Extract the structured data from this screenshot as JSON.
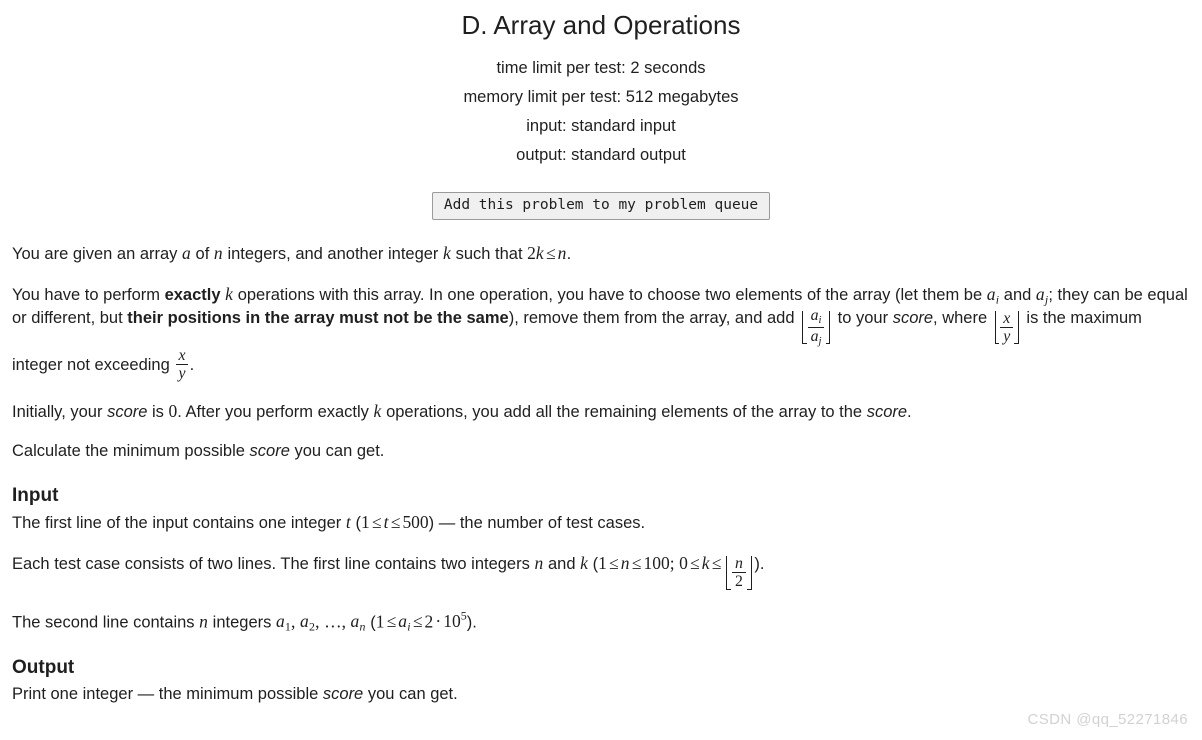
{
  "header": {
    "title": "D. Array and Operations",
    "limits": [
      "time limit per test: 2 seconds",
      "memory limit per test: 512 megabytes",
      "input: standard input",
      "output: standard output"
    ]
  },
  "queue_button": {
    "label": "Add this problem to my problem queue"
  },
  "statement": {
    "p1": {
      "t1": "You are given an array ",
      "a": "a",
      "t2": " of ",
      "n": "n",
      "t3": " integers, and another integer ",
      "k": "k",
      "t4": " such that ",
      "two": "2",
      "k2": "k",
      "le": "≤",
      "n2": "n",
      "t5": "."
    },
    "p2": {
      "t1": "You have to perform ",
      "exactly": "exactly",
      "k": "k",
      "t2": " operations with this array. In one operation, you have to choose two elements of the array (let them be ",
      "a_i_base": "a",
      "a_i_sub": "i",
      "t3": " and ",
      "a_j_base": "a",
      "a_j_sub": "j",
      "t4": "; they can be equal or different, but ",
      "bold_positions": "their positions in the array must not be the same",
      "t5": "), remove them from the array, and add ",
      "frac1_num_base": "a",
      "frac1_num_sub": "i",
      "frac1_den_base": "a",
      "frac1_den_sub": "j",
      "t6": " to your ",
      "score1": "score",
      "t7": ", where ",
      "frac2_num": "x",
      "frac2_den": "y",
      "t8": " is the maximum integer not exceeding ",
      "frac3_num": "x",
      "frac3_den": "y",
      "t9": "."
    },
    "p3": {
      "t1": "Initially, your ",
      "score1": "score",
      "t2": " is ",
      "zero": "0",
      "t3": ". After you perform exactly ",
      "k": "k",
      "t4": " operations, you add all the remaining elements of the array to the ",
      "score2": "score",
      "t5": "."
    },
    "p4": {
      "t1": "Calculate the minimum possible ",
      "score": "score",
      "t2": " you can get."
    }
  },
  "input_section": {
    "heading": "Input",
    "p1": {
      "t1": "The first line of the input contains one integer ",
      "t": "t",
      "t2": " (",
      "one": "1",
      "le1": "≤",
      "t_var": "t",
      "le2": "≤",
      "five_hundred": "500",
      "t3": ") — the number of test cases."
    },
    "p2": {
      "t1": "Each test case consists of two lines. The first line contains two integers ",
      "n": "n",
      "t2": " and ",
      "k": "k",
      "t3": " (",
      "one": "1",
      "le1": "≤",
      "n2": "n",
      "le2": "≤",
      "hundred": "100",
      "semi": ";",
      "zero": "0",
      "le3": "≤",
      "k2": "k",
      "le4": "≤",
      "floor_num": "n",
      "floor_den": "2",
      "t4": ")."
    },
    "p3": {
      "t1": "The second line contains ",
      "n": "n",
      "t2": " integers ",
      "a1_base": "a",
      "a1_sub": "1",
      "comma1": ",",
      "a2_base": "a",
      "a2_sub": "2",
      "comma2": ",",
      "dots": "…",
      "comma3": ",",
      "an_base": "a",
      "an_sub": "n",
      "t3": " (",
      "one": "1",
      "le1": "≤",
      "ai_base": "a",
      "ai_sub": "i",
      "le2": "≤",
      "two": "2",
      "cdot": "·",
      "ten": "10",
      "exp": "5",
      "t4": ")."
    }
  },
  "output_section": {
    "heading": "Output",
    "p1": {
      "t1": "Print one integer — the minimum possible ",
      "score": "score",
      "t2": " you can get."
    }
  },
  "watermark": {
    "text": "CSDN @qq_52271846"
  },
  "colors": {
    "text": "#1f1f1f",
    "button_bg": "#f0f0f0",
    "button_border": "#9a9a9a",
    "watermark": "#d2d2d2"
  }
}
